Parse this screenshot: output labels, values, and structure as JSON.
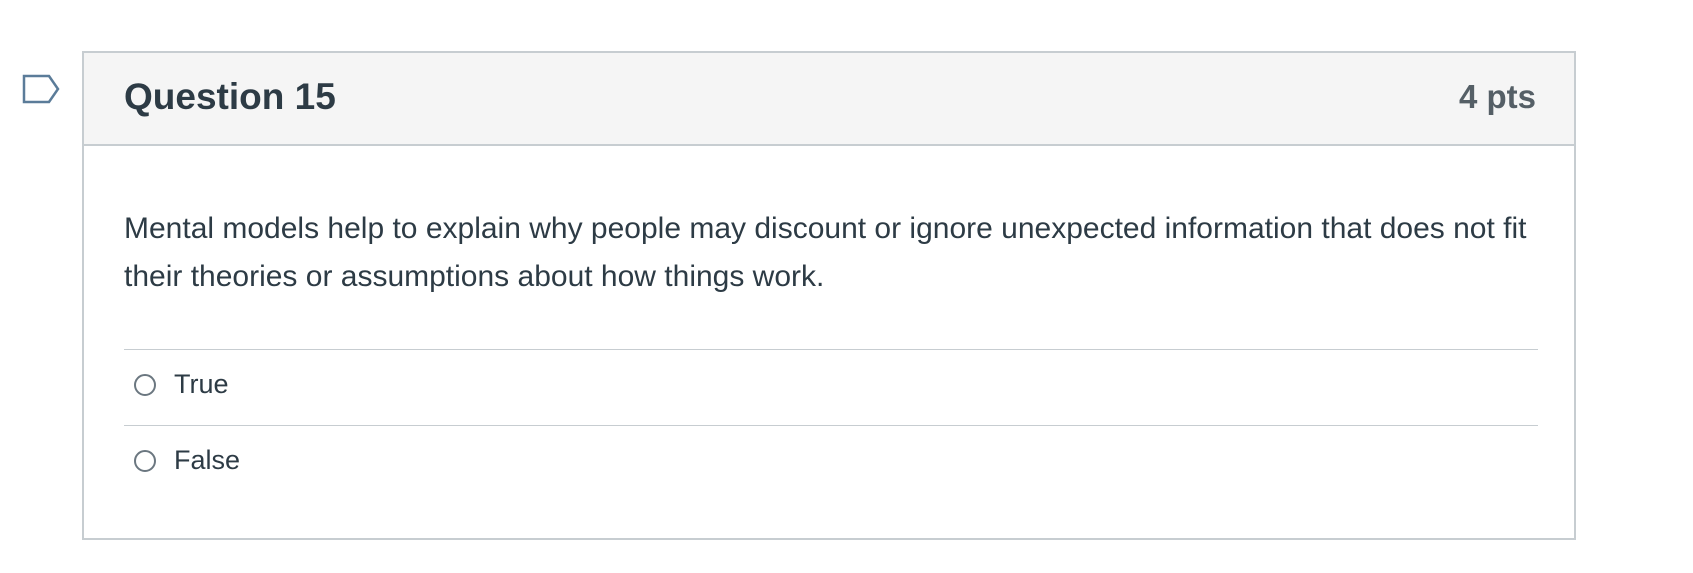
{
  "question": {
    "title": "Question 15",
    "points": "4 pts",
    "text": "Mental models help to explain why people may discount or ignore unexpected information that does not fit their theories or assumptions about how things work.",
    "answers": [
      {
        "label": "True",
        "selected": false
      },
      {
        "label": "False",
        "selected": false
      }
    ]
  },
  "icons": {
    "flag": "bookmark-flag-icon"
  },
  "colors": {
    "header_bg": "#f5f5f5",
    "border": "#c7cdd1",
    "text": "#2d3b45",
    "points": "#555f66",
    "flag": "#5b7c99"
  }
}
